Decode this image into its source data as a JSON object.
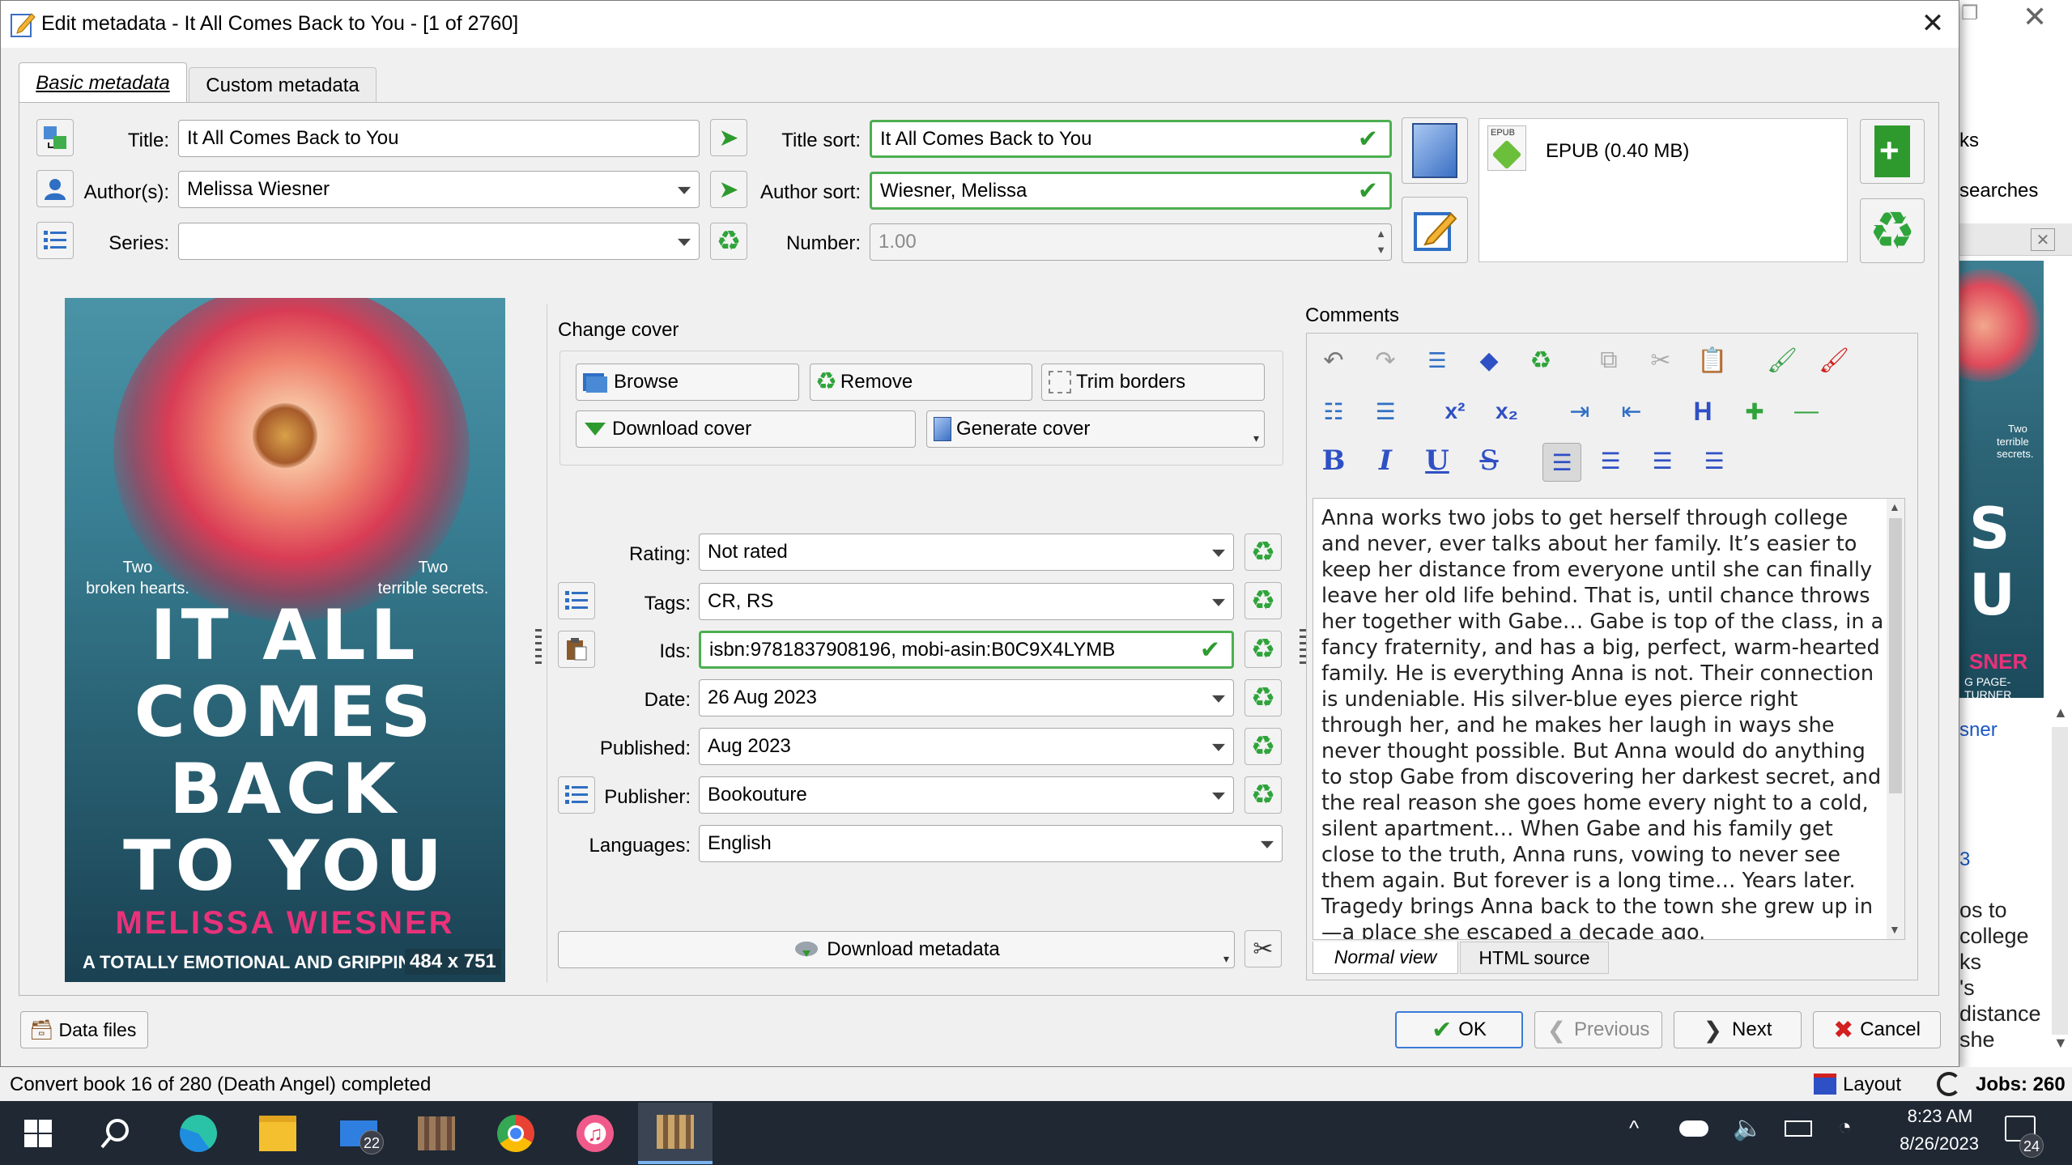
{
  "dialog": {
    "title": "Edit metadata - It All Comes Back to You -  [1 of 2760]",
    "tabs": [
      "Basic metadata",
      "Custom metadata"
    ]
  },
  "fields": {
    "title_label": "Title:",
    "title_value": "It All Comes Back to You",
    "title_sort_label": "Title sort:",
    "title_sort_value": "It All Comes Back to You",
    "authors_label": "Author(s):",
    "authors_value": "Melissa Wiesner",
    "author_sort_label": "Author sort:",
    "author_sort_value": "Wiesner, Melissa",
    "series_label": "Series:",
    "series_value": "",
    "number_label": "Number:",
    "number_value": "1.00"
  },
  "formats": {
    "item_label": "EPUB (0.40 MB)",
    "icon_text": "EPUB"
  },
  "cover": {
    "line_left": "Two\nbroken hearts.",
    "line_right": "Two\nterrible secrets.",
    "title": "IT ALL\nCOMES\nBACK\nTO YOU",
    "author": "MELISSA WIESNER",
    "tagline": "A TOTALLY EMOTIONAL AND GRIPPING PAG",
    "size": "484 x 751"
  },
  "change_cover": {
    "heading": "Change cover",
    "browse": "Browse",
    "remove": "Remove",
    "trim": "Trim borders",
    "download": "Download cover",
    "generate": "Generate cover"
  },
  "meta": {
    "rating_label": "Rating:",
    "rating_value": "Not rated",
    "tags_label": "Tags:",
    "tags_value": "CR, RS",
    "ids_label": "Ids:",
    "ids_value": "isbn:9781837908196, mobi-asin:B0C9X4LYMB",
    "date_label": "Date:",
    "date_value": "26 Aug 2023",
    "published_label": "Published:",
    "published_value": "Aug 2023",
    "publisher_label": "Publisher:",
    "publisher_value": "Bookouture",
    "languages_label": "Languages:",
    "languages_value": "English",
    "download_metadata": "Download metadata"
  },
  "comments": {
    "label": "Comments",
    "text": "Anna works two jobs to get herself through college and never, ever talks about her family. It’s easier to keep her distance from everyone until she can finally leave her old life behind. That is, until chance throws her together with Gabe… Gabe is top of the class, in a fancy fraternity, and has a big, perfect, warm-hearted family. He is everything Anna is not. Their connection is undeniable. His silver-blue eyes pierce right through her, and he makes her laugh in ways she never thought possible. But Anna would do anything to stop Gabe from discovering her darkest secret, and the real reason she goes home every night to a cold, silent apartment… When Gabe and his family get close to the truth, Anna runs, vowing to never see them again. But forever is a long time… Years later. Tragedy brings Anna back to the town she grew up in—a place she escaped a decade ago.",
    "tab_normal": "Normal view",
    "tab_html": "HTML source"
  },
  "footer": {
    "data_files": "Data files",
    "ok": "OK",
    "previous": "Previous",
    "next": "Next",
    "cancel": "Cancel"
  },
  "background": {
    "frag1": "ks",
    "frag2": "searches",
    "frag3": "sner",
    "frag4": "os to\ncollege\nks\n's\ndistance\nshe",
    "status": "Convert book 16 of 280 (Death Angel) completed",
    "layout": "Layout",
    "jobs": "Jobs: 260"
  },
  "taskbar": {
    "time": "8:23 AM",
    "date": "8/26/2023",
    "mail_badge": "22",
    "notif_badge": "24"
  },
  "colors": {
    "accent_green": "#4caf50",
    "cancel_red": "#d32020",
    "taskbar": "#1f2833",
    "cover_title": "#ffffff",
    "cover_author": "#e8327a"
  }
}
